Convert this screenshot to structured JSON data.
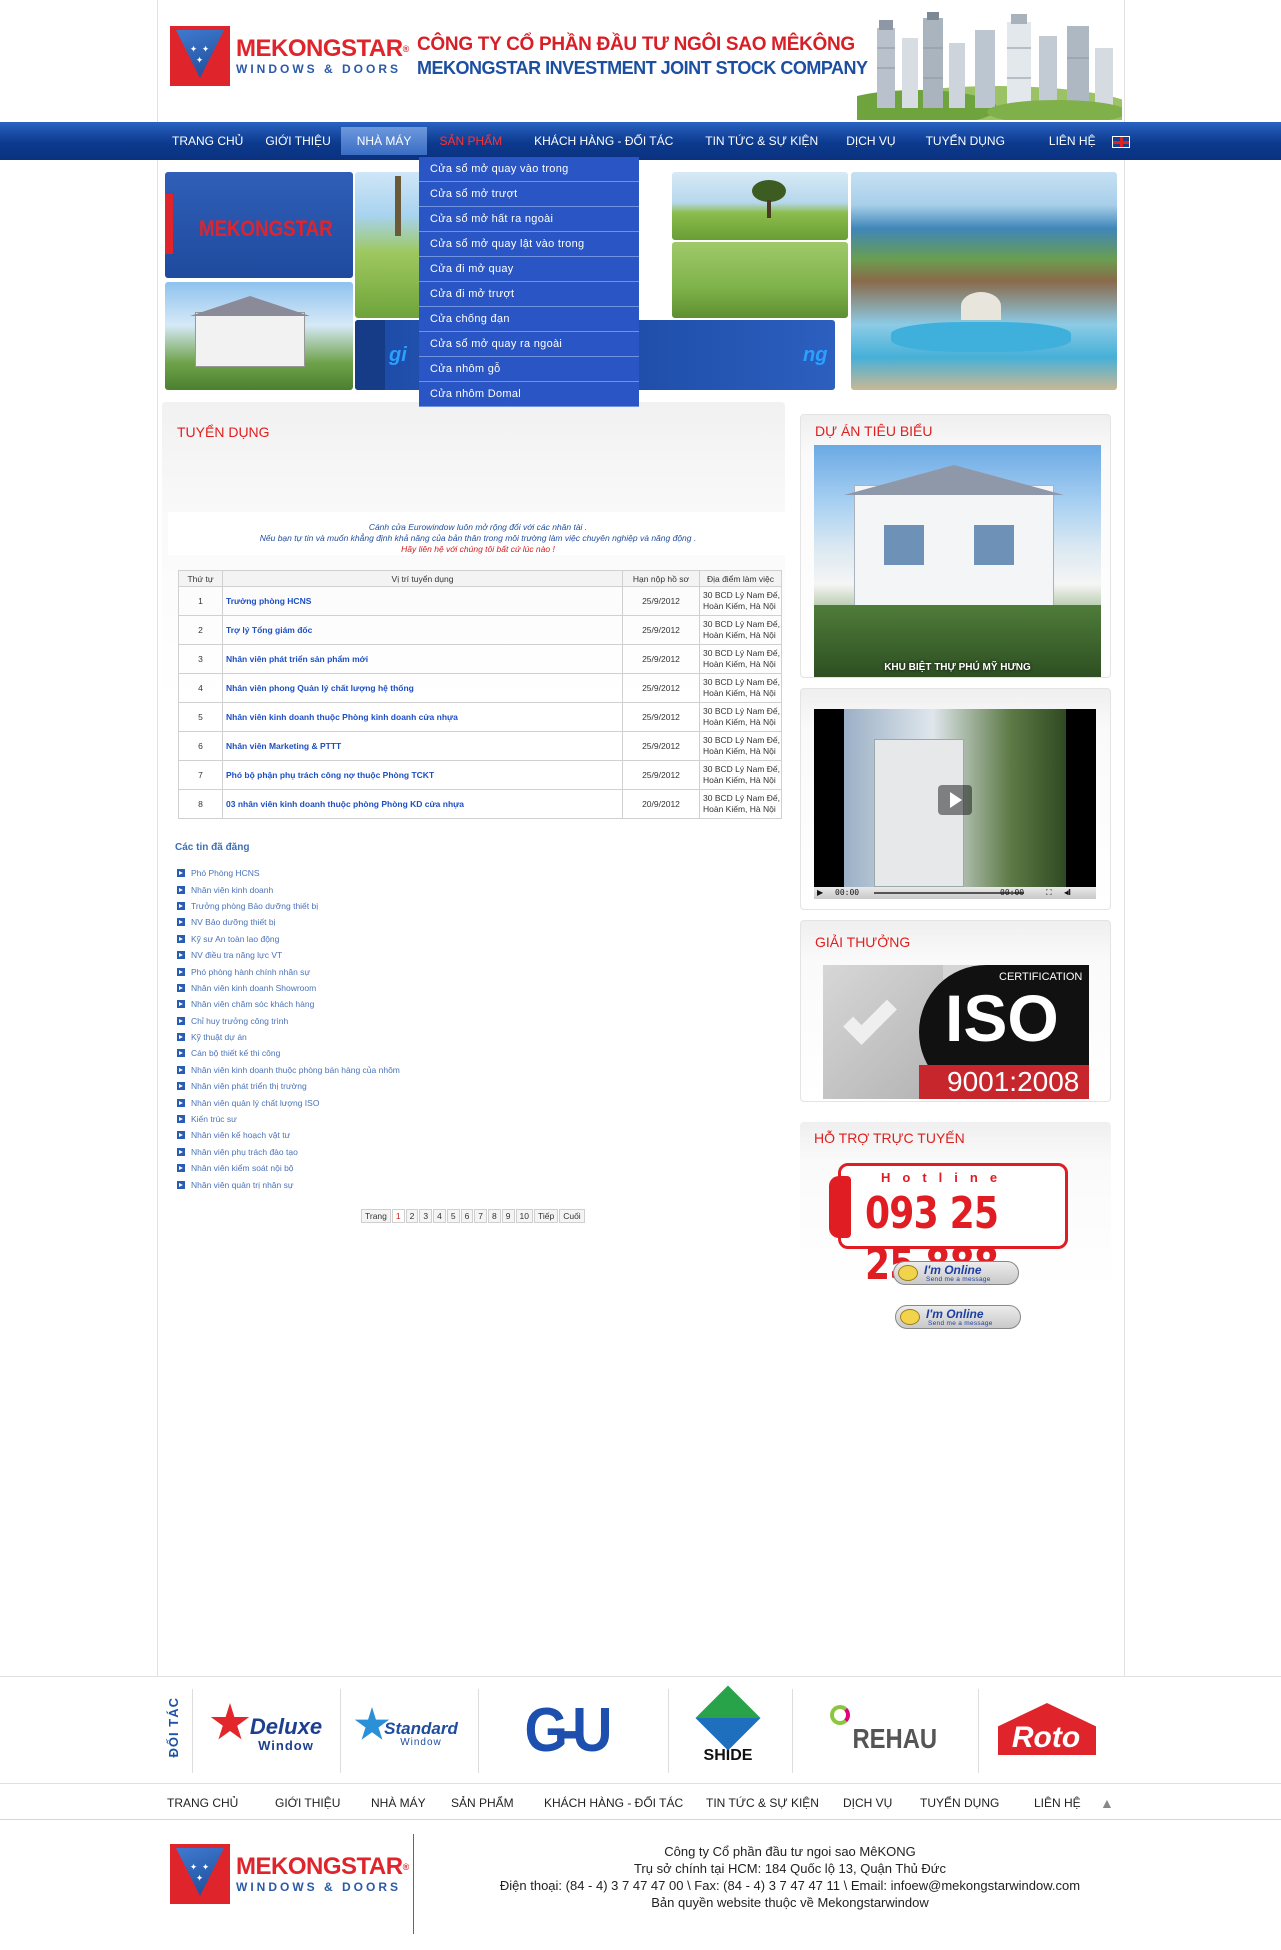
{
  "colors": {
    "brand_red": "#e0242b",
    "brand_blue": "#1c4fa1",
    "nav_blue": "#0c3a8e",
    "title_red": "#e01e1e",
    "link_blue": "#1d4fc4"
  },
  "header": {
    "logo_brand": "MEKONGSTAR",
    "logo_mark": "®",
    "logo_sub": "WINDOWS & DOORS",
    "company_vn": "CÔNG TY CỔ PHẦN ĐẦU TƯ NGÔI SAO MÊKÔNG",
    "company_en": "MEKONGSTAR INVESTMENT JOINT STOCK COMPANY"
  },
  "nav": {
    "items": [
      {
        "label": "TRANG CHỦ"
      },
      {
        "label": "GIỚI THIỆU"
      },
      {
        "label": "NHÀ MÁY"
      },
      {
        "label": "SẢN PHẨM"
      },
      {
        "label": "KHÁCH HÀNG - ĐỐI TÁC"
      },
      {
        "label": "TIN TỨC & SỰ KIỆN"
      },
      {
        "label": "DỊCH VỤ"
      },
      {
        "label": "TUYỂN DỤNG"
      },
      {
        "label": "LIÊN HỆ"
      }
    ],
    "language_icon": "uk-flag-icon"
  },
  "dropdown": {
    "items": [
      "Cửa sổ mở quay vào trong",
      "Cửa sổ mở trượt",
      "Cửa sổ mở hất ra ngoài",
      "Cửa sổ mở quay lật vào trong",
      "Cửa đi mở quay",
      "Cửa đi mở trượt",
      "Cửa chống đạn",
      "Cửa sổ mở quay ra ngoài",
      "Cửa nhôm gỗ",
      "Cửa nhôm Domal"
    ]
  },
  "banner": {
    "logo_text": "MEKONGSTAR",
    "slogan_left": "gi",
    "slogan_right": "ng"
  },
  "content": {
    "title": "TUYỂN DỤNG",
    "intro_line1": "Cánh cửa Eurowindow luôn mở rộng đối với các nhân tài .",
    "intro_line2": "Nếu bạn tự tin và muốn khẳng định khả năng của bản thân trong môi trường làm việc chuyên nghiệp và năng động .",
    "intro_line3": "Hãy liên hệ với chúng tôi bất cứ lúc nào !",
    "table_headers": [
      "Thứ tự",
      "Vị trí tuyển dụng",
      "Hạn nộp hồ sơ",
      "Địa điểm làm việc"
    ],
    "jobs": [
      {
        "no": "1",
        "position": "Trưởng phòng HCNS",
        "deadline": "25/9/2012",
        "addr1": "30 BCD Lý Nam Đế,",
        "addr2": "Hoàn Kiếm, Hà Nội"
      },
      {
        "no": "2",
        "position": "Trợ lý Tổng giám đốc",
        "deadline": "25/9/2012",
        "addr1": "30 BCD Lý Nam Đế,",
        "addr2": "Hoàn Kiếm, Hà Nội"
      },
      {
        "no": "3",
        "position": "Nhân viên phát triển sản phẩm mới",
        "deadline": "25/9/2012",
        "addr1": "30 BCD Lý Nam Đế,",
        "addr2": "Hoàn Kiếm, Hà Nội"
      },
      {
        "no": "4",
        "position": "Nhân viên phong Quản lý chất lượng hệ thống",
        "deadline": "25/9/2012",
        "addr1": "30 BCD Lý Nam Đế,",
        "addr2": "Hoàn Kiếm, Hà Nội"
      },
      {
        "no": "5",
        "position": "Nhân viên kinh doanh thuộc Phòng kinh doanh cửa nhựa",
        "deadline": "25/9/2012",
        "addr1": "30 BCD Lý Nam Đế,",
        "addr2": "Hoàn Kiếm, Hà Nội"
      },
      {
        "no": "6",
        "position": "Nhân viên Marketing & PTTT",
        "deadline": "25/9/2012",
        "addr1": "30 BCD Lý Nam Đế,",
        "addr2": "Hoàn Kiếm, Hà Nội"
      },
      {
        "no": "7",
        "position": "Phó bộ phận phụ trách công nợ thuộc Phòng TCKT",
        "deadline": "25/9/2012",
        "addr1": "30 BCD Lý Nam Đế,",
        "addr2": "Hoàn Kiếm, Hà Nội"
      },
      {
        "no": "8",
        "position": "03 nhân viên kinh doanh thuộc phòng Phòng KD cửa nhựa",
        "deadline": "20/9/2012",
        "addr1": "30 BCD Lý Nam Đế,",
        "addr2": "Hoàn Kiếm, Hà Nội"
      }
    ],
    "posted_title": "Các tin đã đăng",
    "posted": [
      "Phó Phòng HCNS",
      "Nhân viên kinh doanh",
      "Trưởng phòng Bảo dưỡng thiết bị",
      "NV Bảo dưỡng thiết bị",
      "Kỹ sư An toàn lao động",
      "NV điều tra năng lực VT",
      "Phó phòng hành chính nhân sự",
      "Nhân viên kinh doanh Showroom",
      "Nhân viên chăm sóc khách hàng",
      "Chỉ huy trưởng công trình",
      "Kỹ thuật dự án",
      "Cán bộ thiết kế thi công",
      "Nhân viên kinh doanh thuộc phòng bán hàng của nhôm",
      "Nhân viên phát triển thị trường",
      "Nhân viên quản lý chất lượng ISO",
      "Kiến trúc sư",
      "Nhân viên kế hoạch vật tư",
      "Nhân viên phụ trách đào tạo",
      "Nhân viên kiểm soát nội bộ",
      "Nhân viên quản trị nhân sự"
    ],
    "pager": {
      "label": "Trang",
      "pages": [
        "1",
        "2",
        "3",
        "4",
        "5",
        "6",
        "7",
        "8",
        "9",
        "10"
      ],
      "next": "Tiếp",
      "last": "Cuối",
      "current": "1"
    }
  },
  "sidebar": {
    "projects_title": "DỰ ÁN TIÊU BIỂU",
    "project_caption": "KHU BIỆT THỰ PHÚ MỸ HƯNG",
    "video_time_left": "00:00",
    "video_time_right": "00:00",
    "awards_title": "GIẢI THƯỞNG",
    "iso_cert": "CERTIFICATION",
    "iso_big": "ISO",
    "iso_std": "9001:2008",
    "support_title": "HỖ TRỢ TRỰC TUYẾN",
    "hotline_label": "Hotline",
    "hotline_number": "093 25 25 888",
    "online_title": "I'm Online",
    "online_sub": "Send me a message"
  },
  "partners": {
    "label": "ĐỐI TÁC",
    "deluxe": "Deluxe",
    "deluxe_sub": "Window",
    "standard": "Standard",
    "standard_sub": "Window",
    "gu": "G-U",
    "shide": "SHIDE",
    "rehau": "REHAU",
    "roto": "Roto"
  },
  "footer_nav": [
    "TRANG CHỦ",
    "GIỚI THIỆU",
    "NHÀ MÁY",
    "SẢN PHẨM",
    "KHÁCH HÀNG - ĐỐI TÁC",
    "TIN TỨC & SỰ KIỆN",
    "DỊCH VỤ",
    "TUYỂN DỤNG",
    "LIÊN HỆ"
  ],
  "footer": {
    "line1": "Công ty Cổ phần đầu tư ngoi sao MêKONG",
    "line2": "Trụ sở chính tại HCM: 184 Quốc lộ 13, Quận Thủ Đức",
    "line3": "Điện thoại: (84 - 4) 3 7 47 47 00  \\  Fax:  (84 - 4) 3 7 47 47 11  \\  Email: infoew@mekongstarwindow.com",
    "line4": "Bản quyền website thuộc về Mekongstarwindow"
  }
}
